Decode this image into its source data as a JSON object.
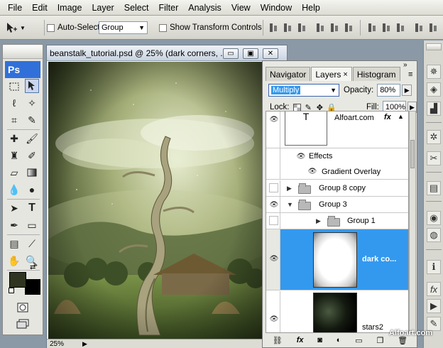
{
  "menubar": {
    "items": [
      "File",
      "Edit",
      "Image",
      "Layer",
      "Select",
      "Filter",
      "Analysis",
      "View",
      "Window",
      "Help"
    ]
  },
  "options": {
    "auto_select_label": "Auto-Select:",
    "auto_select_value": "Group",
    "show_transform_label": "Show Transform Controls"
  },
  "toolbox": {
    "logo": "Ps",
    "foreground_color": "#2f3520",
    "background_color": "#000000"
  },
  "document": {
    "title": "beanstalk_tutorial.psd @ 25% (dark corners, ...",
    "zoom": "25%",
    "btn_minimize": "▭",
    "btn_maximize": "▣",
    "btn_close": "✕"
  },
  "panel": {
    "tabs": [
      "Navigator",
      "Layers",
      "Histogram"
    ],
    "tab_close": "×",
    "menu_icon": "»",
    "blend_mode": "Multiply",
    "opacity_label": "Opacity:",
    "opacity_value": "80%",
    "lock_label": "Lock:",
    "fill_label": "Fill:",
    "fill_value": "100%",
    "layers": [
      {
        "name": "Alfoart.com",
        "type": "text"
      },
      {
        "name": "Effects",
        "type": "effects"
      },
      {
        "name": "Gradient Overlay",
        "type": "effect"
      },
      {
        "name": "Group 8 copy",
        "type": "group"
      },
      {
        "name": "Group 3",
        "type": "group"
      },
      {
        "name": "Group 1",
        "type": "group"
      },
      {
        "name": "dark co...",
        "type": "layer"
      },
      {
        "name": "stars2",
        "type": "layer"
      }
    ],
    "text_thumb_glyph": "T",
    "fx_glyph": "fx"
  },
  "watermark": "Alfoart.com",
  "colors": {
    "selection": "#3399ee",
    "ps_blue": "#3070d8"
  }
}
